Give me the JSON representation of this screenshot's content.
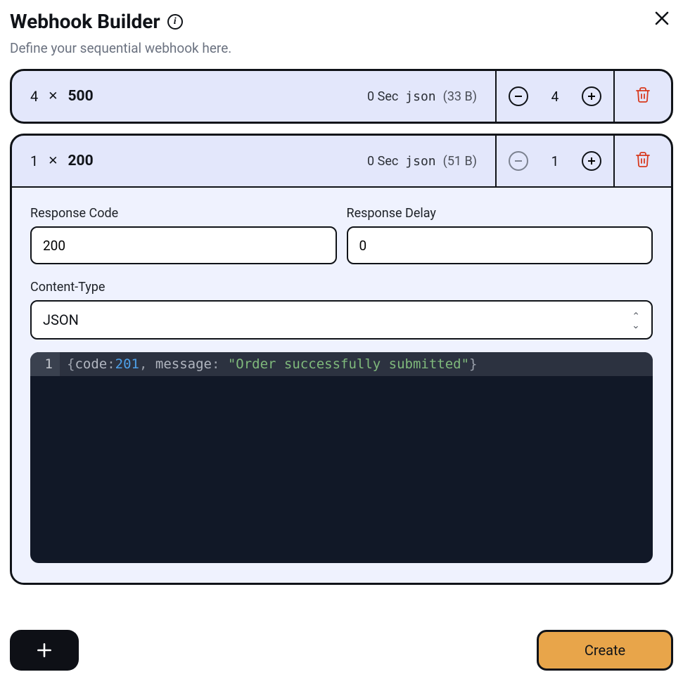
{
  "header": {
    "title": "Webhook Builder",
    "subtitle": "Define your sequential webhook here."
  },
  "items": [
    {
      "count": "4",
      "status": "500",
      "delay_label": "0 Sec",
      "type_label": "json",
      "bytes_label": "(33 B)",
      "counter": "4",
      "decrement_disabled": false,
      "expanded": false
    },
    {
      "count": "1",
      "status": "200",
      "delay_label": "0 Sec",
      "type_label": "json",
      "bytes_label": "(51 B)",
      "counter": "1",
      "decrement_disabled": true,
      "expanded": true,
      "form": {
        "response_code_label": "Response Code",
        "response_code_value": "200",
        "response_delay_label": "Response Delay",
        "response_delay_value": "0",
        "content_type_label": "Content-Type",
        "content_type_value": "JSON"
      },
      "editor": {
        "line_no": "1",
        "tokens": {
          "open": "{",
          "k1": "code",
          "c1": ":",
          "v1": "201",
          "sep": ", ",
          "k2": "message",
          "c2": ": ",
          "v2": "\"Order successfully submitted\"",
          "close": "}"
        }
      }
    }
  ],
  "footer": {
    "create_label": "Create"
  }
}
